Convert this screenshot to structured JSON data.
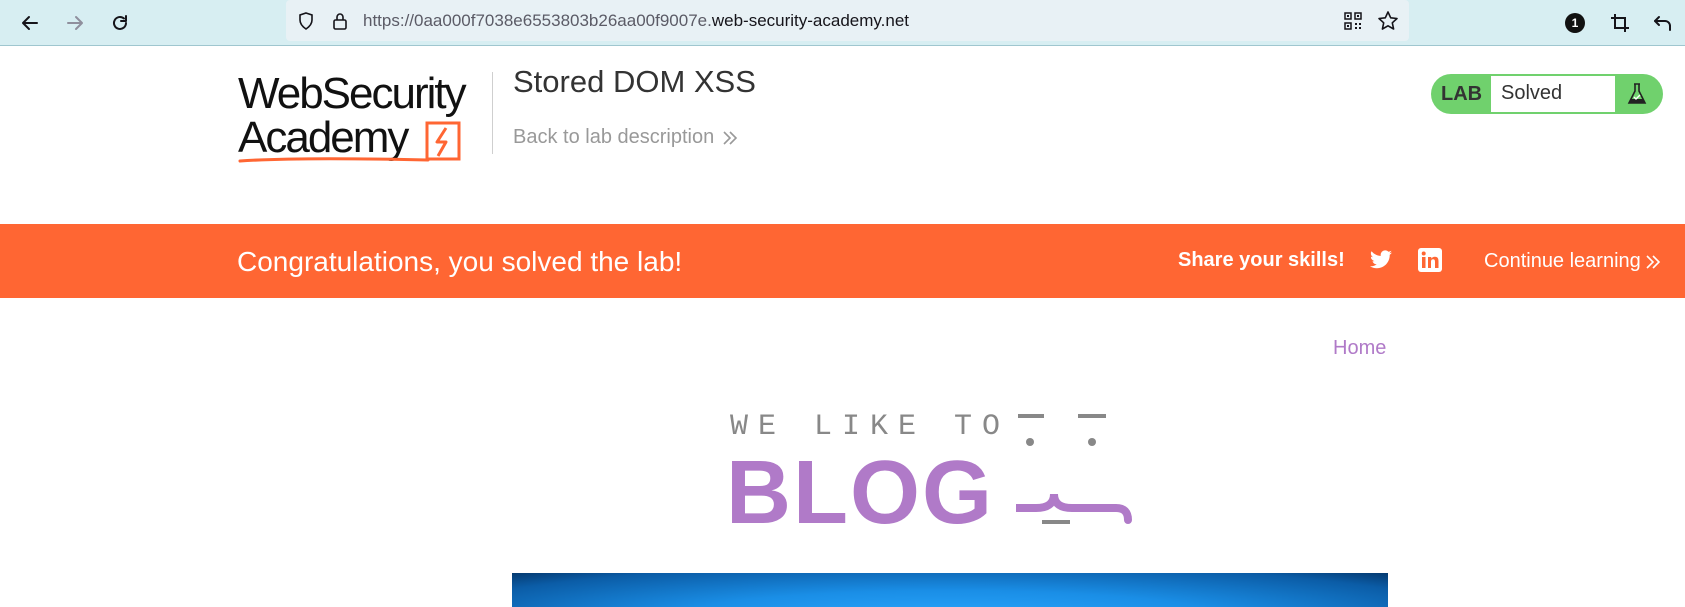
{
  "browser": {
    "url_prefix": "https://0aa000f7038e6553803b26aa00f9007e.",
    "url_domain": "web-security-academy.net",
    "extension_badge": "1"
  },
  "header": {
    "logo_line1": "WebSecurity",
    "logo_line2": "Academy",
    "lab_title": "Stored DOM XSS",
    "back_link": "Back to lab description",
    "lab_badge_label": "LAB",
    "lab_status": "Solved"
  },
  "banner": {
    "message": "Congratulations, you solved the lab!",
    "share_label": "Share your skills!",
    "continue_label": "Continue learning"
  },
  "blog": {
    "home_link": "Home",
    "tagline": "WE LIKE TO",
    "title": "BLOG"
  },
  "colors": {
    "banner": "#ff6633",
    "lab_badge": "#70d16d",
    "blog_purple": "#b07ac8",
    "browser_bar": "#d7eef2"
  }
}
